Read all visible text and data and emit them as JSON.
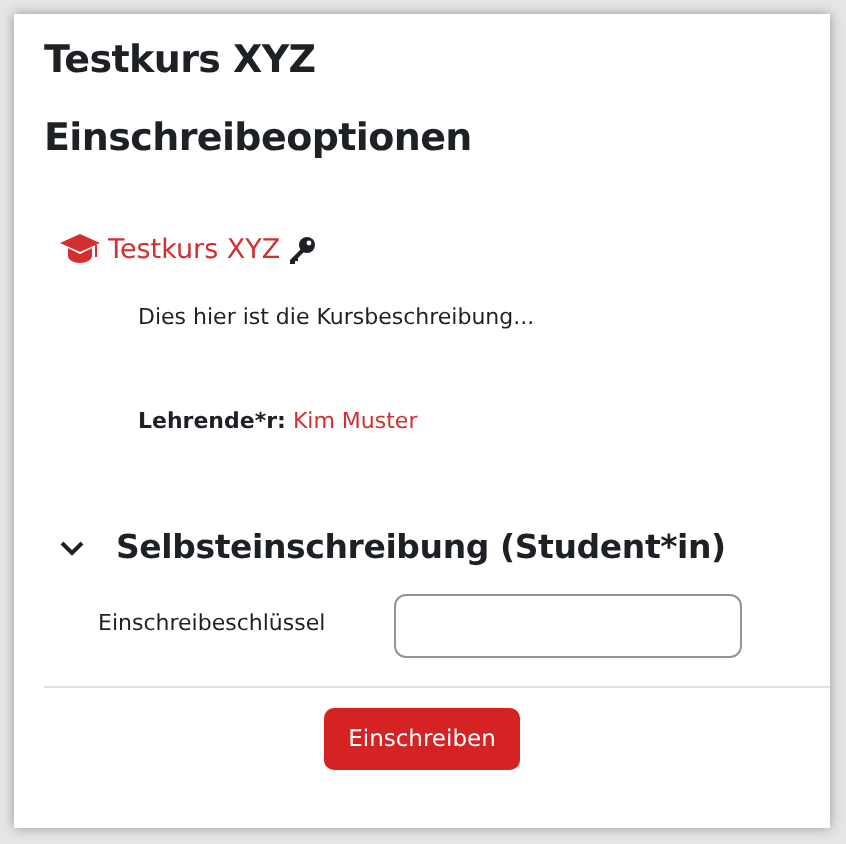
{
  "page_title": "Testkurs XYZ",
  "heading": "Einschreibeoptionen",
  "course": {
    "name": "Testkurs XYZ",
    "description": "Dies hier ist die Kursbeschreibung...",
    "teacher_label": "Lehrende*r:",
    "teacher": "Kim Muster"
  },
  "section": {
    "title": "Selbsteinschreibung (Student*in)",
    "expanded": true,
    "field": {
      "label": "Einschreibeschlüssel"
    },
    "button": "Einschreiben"
  }
}
